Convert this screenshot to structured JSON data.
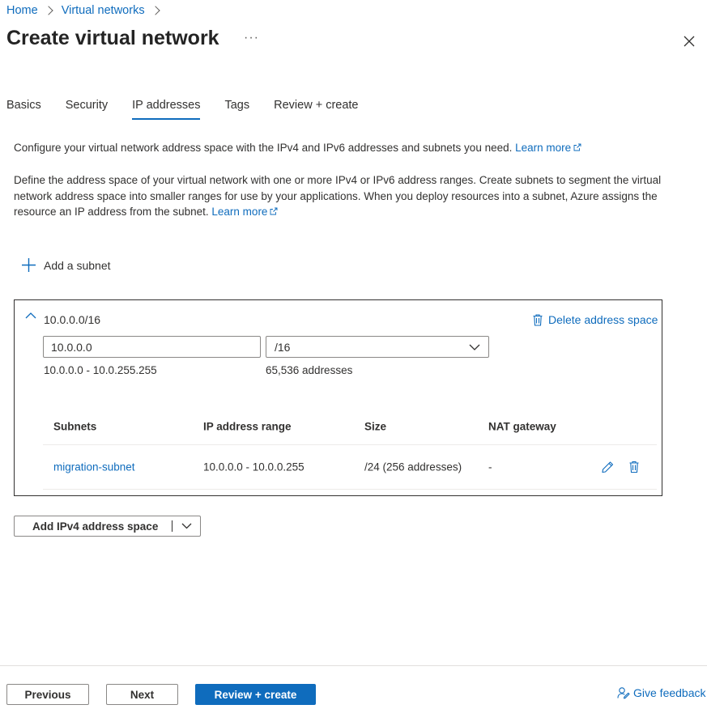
{
  "breadcrumb": [
    {
      "label": "Home"
    },
    {
      "label": "Virtual networks"
    }
  ],
  "page": {
    "title": "Create virtual network"
  },
  "tabs": [
    {
      "label": "Basics"
    },
    {
      "label": "Security"
    },
    {
      "label": "IP addresses",
      "active": true
    },
    {
      "label": "Tags"
    },
    {
      "label": "Review + create"
    }
  ],
  "intro": {
    "text1": "Configure your virtual network address space with the IPv4 and IPv6 addresses and subnets you need.",
    "link1": "Learn more",
    "text2": "Define the address space of your virtual network with one or more IPv4 or IPv6 address ranges. Create subnets to segment the virtual network address space into smaller ranges for use by your applications. When you deploy resources into a subnet, Azure assigns the resource an IP address from the subnet.",
    "link2": "Learn more"
  },
  "add_subnet_label": "Add a subnet",
  "address_space": {
    "title": "10.0.0.0/16",
    "delete_label": "Delete address space",
    "ip_value": "10.0.0.0",
    "cidr_value": "/16",
    "range_text": "10.0.0.0 - 10.0.255.255",
    "count_text": "65,536 addresses",
    "columns": [
      "Subnets",
      "IP address range",
      "Size",
      "NAT gateway"
    ],
    "subnets": [
      {
        "name": "migration-subnet",
        "range": "10.0.0.0 - 10.0.0.255",
        "size": "/24 (256 addresses)",
        "nat": "-"
      }
    ]
  },
  "add_ipv4_label": "Add IPv4 address space",
  "footer": {
    "previous": "Previous",
    "next": "Next",
    "review": "Review + create",
    "feedback": "Give feedback"
  },
  "colors": {
    "accent": "#0f6cbd",
    "text": "#323130",
    "border": "#8a8886"
  },
  "icons": [
    "chevron-right-icon",
    "more-icon",
    "close-icon",
    "external-link-icon",
    "plus-icon",
    "chevron-up-icon",
    "trash-icon",
    "chevron-down-icon",
    "pencil-icon",
    "feedback-icon"
  ]
}
